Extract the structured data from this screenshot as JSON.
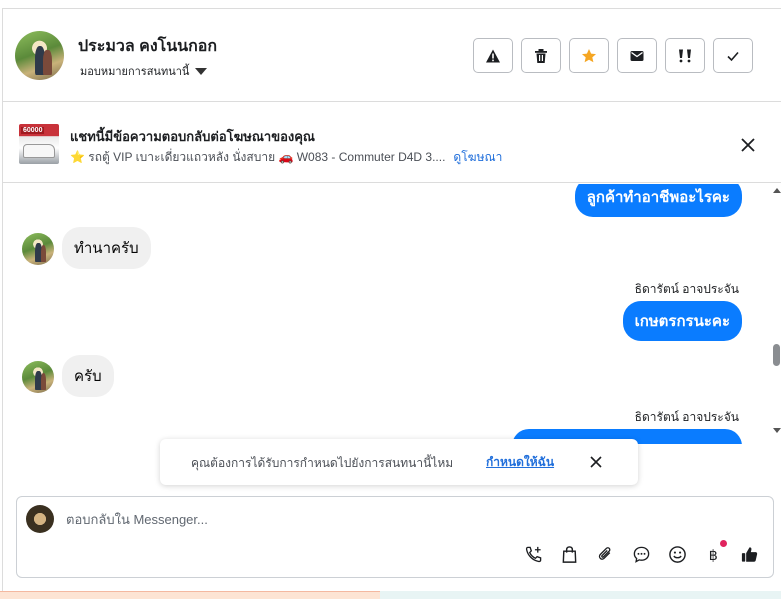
{
  "header": {
    "name": "ประมวล คงโนนกอก",
    "assign_label": "มอบหมายการสนทนานี้",
    "tools": [
      {
        "name": "report-spam-button",
        "icon": "warning-icon"
      },
      {
        "name": "delete-button",
        "icon": "trash-icon"
      },
      {
        "name": "star-button",
        "icon": "star-icon"
      },
      {
        "name": "mark-unread-button",
        "icon": "envelope-icon"
      },
      {
        "name": "follow-up-button",
        "icon": "important-icon"
      },
      {
        "name": "mark-done-button",
        "icon": "check-icon"
      }
    ]
  },
  "ad": {
    "title": "แชทนี้มีข้อความตอบกลับต่อโฆษณาของคุณ",
    "thumb_badge": "60000",
    "description": "⭐ รถตู้ VIP เบาะเดี่ยวแถวหลัง นั่งสบาย 🚗 W083 - Commuter D4D 3....",
    "link": "ดูโฆษณา"
  },
  "messages": {
    "m1": "ลูกค้าทำอาชีพอะไรคะ",
    "m2": "ทำนาครับ",
    "sender1": "ธิดารัตน์ อาจประจัน",
    "m3": "เกษตรกรนะคะ",
    "m4": "ครับ",
    "sender2": "ธิดารัตน์ อาจประจัน"
  },
  "toast": {
    "text": "คุณต้องการได้รับการกำหนดไปยังการสนทนานี้ไหม",
    "link": "กำหนดให้ฉัน"
  },
  "composer": {
    "placeholder": "ตอบกลับใน Messenger...",
    "icons": [
      "call-add-icon",
      "shopping-bag-icon",
      "attachment-icon",
      "chat-bubble-icon",
      "emoji-icon",
      "baht-icon",
      "thumbs-up-icon"
    ]
  },
  "colors": {
    "accent": "#0a7cff",
    "link": "#216fdb",
    "star": "#f5a623"
  }
}
